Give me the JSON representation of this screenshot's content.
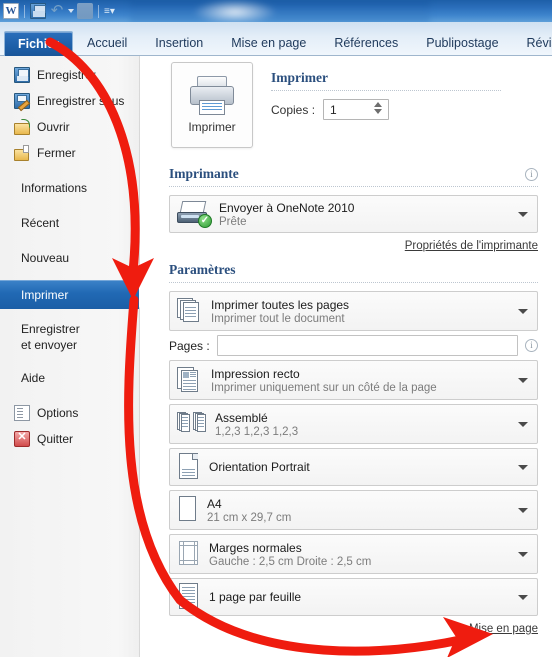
{
  "app": {
    "logo_text": "W",
    "quick_access": [
      {
        "name": "save-icon",
        "label": "Enregistrer"
      },
      {
        "name": "undo-icon",
        "label": "Annuler"
      },
      {
        "name": "redo-icon",
        "label": "Répéter"
      },
      {
        "name": "customize-qat-icon",
        "label": "Personnaliser la barre d'outils Accès rapide"
      }
    ]
  },
  "ribbon": {
    "file_tab": "Fichier",
    "tabs": [
      "Accueil",
      "Insertion",
      "Mise en page",
      "Références",
      "Publipostage",
      "Révision"
    ]
  },
  "nav": {
    "items": [
      {
        "label": "Enregistrer",
        "icon": "save-icon",
        "selected": false
      },
      {
        "label": "Enregistrer sous",
        "icon": "save-as-icon",
        "selected": false
      },
      {
        "label": "Ouvrir",
        "icon": "open-folder-icon",
        "selected": false
      },
      {
        "label": "Fermer",
        "icon": "close-folder-icon",
        "selected": false
      },
      {
        "label": "Informations",
        "icon": null,
        "selected": false
      },
      {
        "label": "Récent",
        "icon": null,
        "selected": false
      },
      {
        "label": "Nouveau",
        "icon": null,
        "selected": false
      },
      {
        "label": "Imprimer",
        "icon": null,
        "selected": true
      },
      {
        "label": "Enregistrer\n et envoyer",
        "icon": null,
        "selected": false
      },
      {
        "label": "Aide",
        "icon": null,
        "selected": false
      },
      {
        "label": "Options",
        "icon": "options-icon",
        "selected": false
      },
      {
        "label": "Quitter",
        "icon": "quit-icon",
        "selected": false
      }
    ]
  },
  "print": {
    "button_label": "Imprimer",
    "heading": "Imprimer",
    "copies_label": "Copies :",
    "copies_value": "1",
    "printer_section_title": "Imprimante",
    "printer_name": "Envoyer à OneNote 2010",
    "printer_status": "Prête",
    "printer_properties_link": "Propriétés de l'imprimante",
    "settings_section_title": "Paramètres",
    "settings": [
      {
        "main": "Imprimer toutes les pages",
        "sub": "Imprimer tout le document",
        "icon": "pages-stack-icon"
      },
      {
        "main": "Impression recto",
        "sub": "Imprimer uniquement sur un côté de la page",
        "icon": "one-sided-icon"
      },
      {
        "main": "Assemblé",
        "sub": "1,2,3   1,2,3   1,2,3",
        "icon": "collate-icon"
      },
      {
        "main": "Orientation Portrait",
        "sub": "",
        "icon": "portrait-icon"
      },
      {
        "main": "A4",
        "sub": "21 cm x 29,7 cm",
        "icon": "paper-size-icon"
      },
      {
        "main": "Marges normales",
        "sub": "Gauche : 2,5 cm   Droite : 2,5 cm",
        "icon": "margins-icon"
      },
      {
        "main": "1 page par feuille",
        "sub": "",
        "icon": "pages-per-sheet-icon"
      }
    ],
    "pages_label": "Pages :",
    "pages_value": "",
    "page_setup_link": "Mise en page"
  },
  "annotations": {
    "arrow_color": "#ef1c0f",
    "arrows": [
      {
        "name": "arrow-fichier-to-imprimer",
        "from": "Fichier",
        "to": "Imprimer"
      },
      {
        "name": "arrow-imprimer-to-mise-en-page",
        "from": "Imprimer",
        "to": "Mise en page"
      }
    ]
  }
}
